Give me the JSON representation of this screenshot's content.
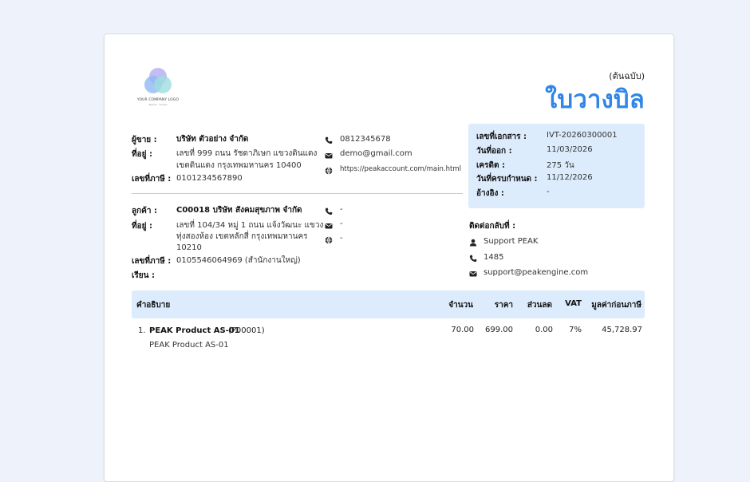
{
  "logo": {
    "text": "YOUR COMPANY LOGO",
    "sub": "Tagline · Slogan"
  },
  "header": {
    "kind": "(ต้นฉบับ)",
    "title": "ใบวางบิล"
  },
  "seller": {
    "label_seller": "ผู้ขาย :",
    "name": "บริษัท ตัวอย่าง จำกัด",
    "label_address": "ที่อยู่ :",
    "address_line1": "เลขที่ 999 ถนน รัชดาภิเษก แขวงดินแดง",
    "address_line2": "เขตดินแดง กรุงเทพมหานคร 10400",
    "label_tax": "เลขที่ภาษี :",
    "tax_id": "0101234567890",
    "phone": "0812345678",
    "email": "demo@gmail.com",
    "website": "https://peakaccount.com/main.html"
  },
  "customer": {
    "label_customer": "ลูกค้า :",
    "name": "C00018 บริษัท สังคมสุขภาพ จำกัด",
    "label_address": "ที่อยู่ :",
    "address_line1": "เลขที่ 104/34 หมู่ 1 ถนน แจ้งวัฒนะ แขวง",
    "address_line2": "ทุ่งสองห้อง เขตหลักสี่ กรุงเทพมหานคร",
    "address_line3": "10210",
    "label_tax": "เลขที่ภาษี :",
    "tax_id": "0105546064969 (สำนักงานใหญ่)",
    "label_attn": "เรียน :",
    "phone": "-",
    "email": "-",
    "website": "-"
  },
  "doc_info": {
    "doc_no_label": "เลขที่เอกสาร :",
    "doc_no": "IVT-20260300001",
    "issue_label": "วันที่ออก :",
    "issue_date": "11/03/2026",
    "credit_label": "เครดิต :",
    "credit": "275 วัน",
    "due_label": "วันที่ครบกำหนด :",
    "due_date": "11/12/2026",
    "ref_label": "อ้างอิง :",
    "ref": "-"
  },
  "contact": {
    "title": "ติดต่อกลับที่ :",
    "name": "Support PEAK",
    "phone": "1485",
    "email": "support@peakengine.com"
  },
  "table": {
    "headers": {
      "description": "คำอธิบาย",
      "quantity": "จำนวน",
      "price": "ราคา",
      "discount": "ส่วนลด",
      "vat": "VAT",
      "amount": "มูลค่าก่อนภาษี"
    },
    "rows": [
      {
        "no": "1.",
        "name": "PEAK Product AS-01",
        "code": "(P00001)",
        "desc": "PEAK Product AS-01",
        "quantity": "70.00",
        "price": "699.00",
        "discount": "0.00",
        "vat": "7%",
        "amount": "45,728.97"
      }
    ]
  },
  "colors": {
    "accent": "#2f86e8",
    "panel": "#dcecfc",
    "page_bg": "#eef3fb"
  }
}
